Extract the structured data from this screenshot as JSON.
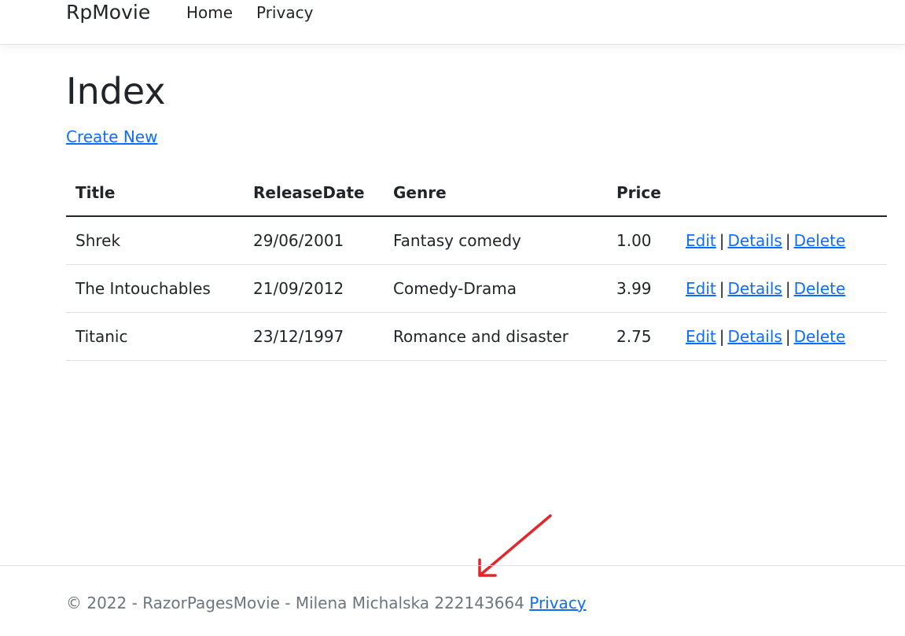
{
  "navbar": {
    "brand": "RpMovie",
    "links": [
      "Home",
      "Privacy"
    ]
  },
  "page": {
    "title": "Index",
    "create_link": "Create New"
  },
  "table": {
    "headers": [
      "Title",
      "ReleaseDate",
      "Genre",
      "Price"
    ],
    "rows": [
      {
        "title": "Shrek",
        "release_date": "29/06/2001",
        "genre": "Fantasy comedy",
        "price": "1.00"
      },
      {
        "title": "The Intouchables",
        "release_date": "21/09/2012",
        "genre": "Comedy-Drama",
        "price": "3.99"
      },
      {
        "title": "Titanic",
        "release_date": "23/12/1997",
        "genre": "Romance and disaster",
        "price": "2.75"
      }
    ],
    "actions": {
      "edit": "Edit",
      "details": "Details",
      "delete": "Delete",
      "separator": "|"
    }
  },
  "footer": {
    "text": "© 2022 - RazorPagesMovie - Milena Michalska 222143664",
    "privacy_link": "Privacy"
  },
  "annotation": {
    "arrow_color": "#e3262a"
  },
  "colors": {
    "link": "#0d6efd",
    "muted": "#6c757d",
    "text": "#212529"
  }
}
